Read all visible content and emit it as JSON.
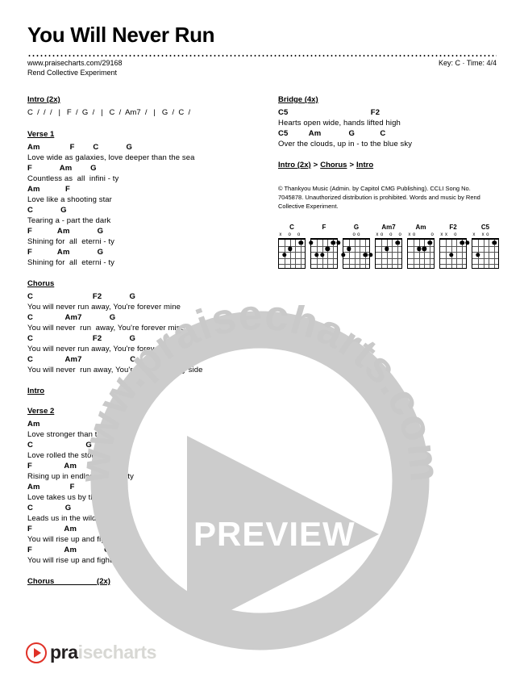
{
  "header": {
    "title": "You Will Never Run",
    "url": "www.praisecharts.com/29168",
    "artist": "Rend Collective Experiment",
    "key_time": "Key: C · Time: 4/4"
  },
  "left_column": {
    "intro": {
      "heading": "Intro (2x)",
      "progression": "C  /  /  /   |   F  /  G  /   |   C  /  Am7  /   |   G  /  C  /"
    },
    "verse1": {
      "heading": "Verse 1",
      "lines": [
        {
          "chords": "Am             F        C            G",
          "lyric": "Love wide as galaxies, love deeper than the sea"
        },
        {
          "chords": "F            Am        G",
          "lyric": "Countless as  all  infini - ty"
        },
        {
          "chords": "Am           F",
          "lyric": "Love like a shooting star"
        },
        {
          "chords": "C            G",
          "lyric": "Tearing a - part the dark"
        },
        {
          "chords": "F           Am            G",
          "lyric": "Shining for  all  eterni - ty"
        },
        {
          "chords": "F           Am            G",
          "lyric": "Shining for  all  eterni - ty"
        }
      ]
    },
    "chorus": {
      "heading": "Chorus",
      "lines": [
        {
          "chords": "C                          F2            G",
          "lyric": "You will never run away, You're forever mine"
        },
        {
          "chords": "C              Am7            G",
          "lyric": "You will never  run  away, You're forever mine"
        },
        {
          "chords": "C                          F2            G",
          "lyric": "You will never run away, You're forever mine"
        },
        {
          "chords": "C              Am7                     C",
          "lyric": "You will never  run away, You're always by my side"
        }
      ]
    },
    "intro_reprise": {
      "heading": "Intro"
    },
    "verse2": {
      "heading": "Verse 2",
      "lines": [
        {
          "chords": "Am",
          "lyric": "Love stronger than the grave"
        },
        {
          "chords": "C                       G",
          "lyric": "Love rolled the stone away"
        },
        {
          "chords": "F              Am               G",
          "lyric": "Rising up in endless majes - ty"
        },
        {
          "chords": "Am             F",
          "lyric": "Love takes us by the hand"
        },
        {
          "chords": "C              G",
          "lyric": "Leads us in the wildest dance"
        },
        {
          "chords": "F              Am            G",
          "lyric": "You will rise up and fight in me"
        },
        {
          "chords": "F              Am            G",
          "lyric": "You will rise up and fight in me"
        }
      ]
    },
    "chorus_repeat": {
      "heading": "Chorus",
      "repeat": "(2x)"
    }
  },
  "right_column": {
    "bridge": {
      "heading": "Bridge (4x)",
      "lines": [
        {
          "chords": "C5                                    F2",
          "lyric": "Hearts open wide, hands lifted high"
        },
        {
          "chords": "C5         Am            G           C",
          "lyric": "Over the clouds, up in - to the blue sky"
        }
      ]
    },
    "flow": [
      "Intro (2x)",
      "Chorus",
      "Intro"
    ],
    "flow_separator": ">",
    "copyright": "© Thankyou Music (Admin. by Capitol CMG Publishing). CCLI Song No. 7045878. Unauthorized distribution is prohibited. Words and music by Rend Collective Experiment.",
    "chord_diagrams": [
      {
        "name": "C",
        "markers": [
          "x",
          "",
          "o",
          "",
          "o",
          ""
        ],
        "dots": [
          [
            5,
            3
          ],
          [
            4,
            2
          ],
          [
            2,
            1
          ]
        ]
      },
      {
        "name": "F",
        "markers": [
          "",
          "",
          "",
          "",
          "",
          ""
        ],
        "dots": [
          [
            6,
            1
          ],
          [
            3,
            2
          ],
          [
            2,
            1
          ],
          [
            1,
            1
          ],
          [
            5,
            3
          ],
          [
            4,
            3
          ]
        ]
      },
      {
        "name": "G",
        "markers": [
          "",
          "",
          "o",
          "o",
          "",
          ""
        ],
        "dots": [
          [
            6,
            3
          ],
          [
            5,
            2
          ],
          [
            2,
            3
          ],
          [
            1,
            3
          ]
        ]
      },
      {
        "name": "Am7",
        "markers": [
          "x",
          "o",
          "",
          "o",
          "",
          "o"
        ],
        "dots": [
          [
            4,
            2
          ],
          [
            2,
            1
          ]
        ]
      },
      {
        "name": "Am",
        "markers": [
          "x",
          "o",
          "",
          "",
          "",
          "o"
        ],
        "dots": [
          [
            4,
            2
          ],
          [
            3,
            2
          ],
          [
            2,
            1
          ]
        ]
      },
      {
        "name": "F2",
        "markers": [
          "x",
          "x",
          "",
          "o",
          "",
          ""
        ],
        "dots": [
          [
            4,
            3
          ],
          [
            2,
            1
          ],
          [
            1,
            1
          ]
        ]
      },
      {
        "name": "C5",
        "markers": [
          "x",
          "",
          "x",
          "o",
          "",
          ""
        ],
        "dots": [
          [
            5,
            3
          ],
          [
            2,
            1
          ]
        ]
      }
    ]
  },
  "watermark": {
    "ring_text": "www.praisecharts.com",
    "preview_label": "PREVIEW"
  },
  "footer": {
    "logo_text_visible": "pra",
    "logo_text_faded": "isecharts"
  },
  "colors": {
    "brand_red": "#e03127",
    "watermark_gray": "#cccccc",
    "text": "#000000"
  }
}
